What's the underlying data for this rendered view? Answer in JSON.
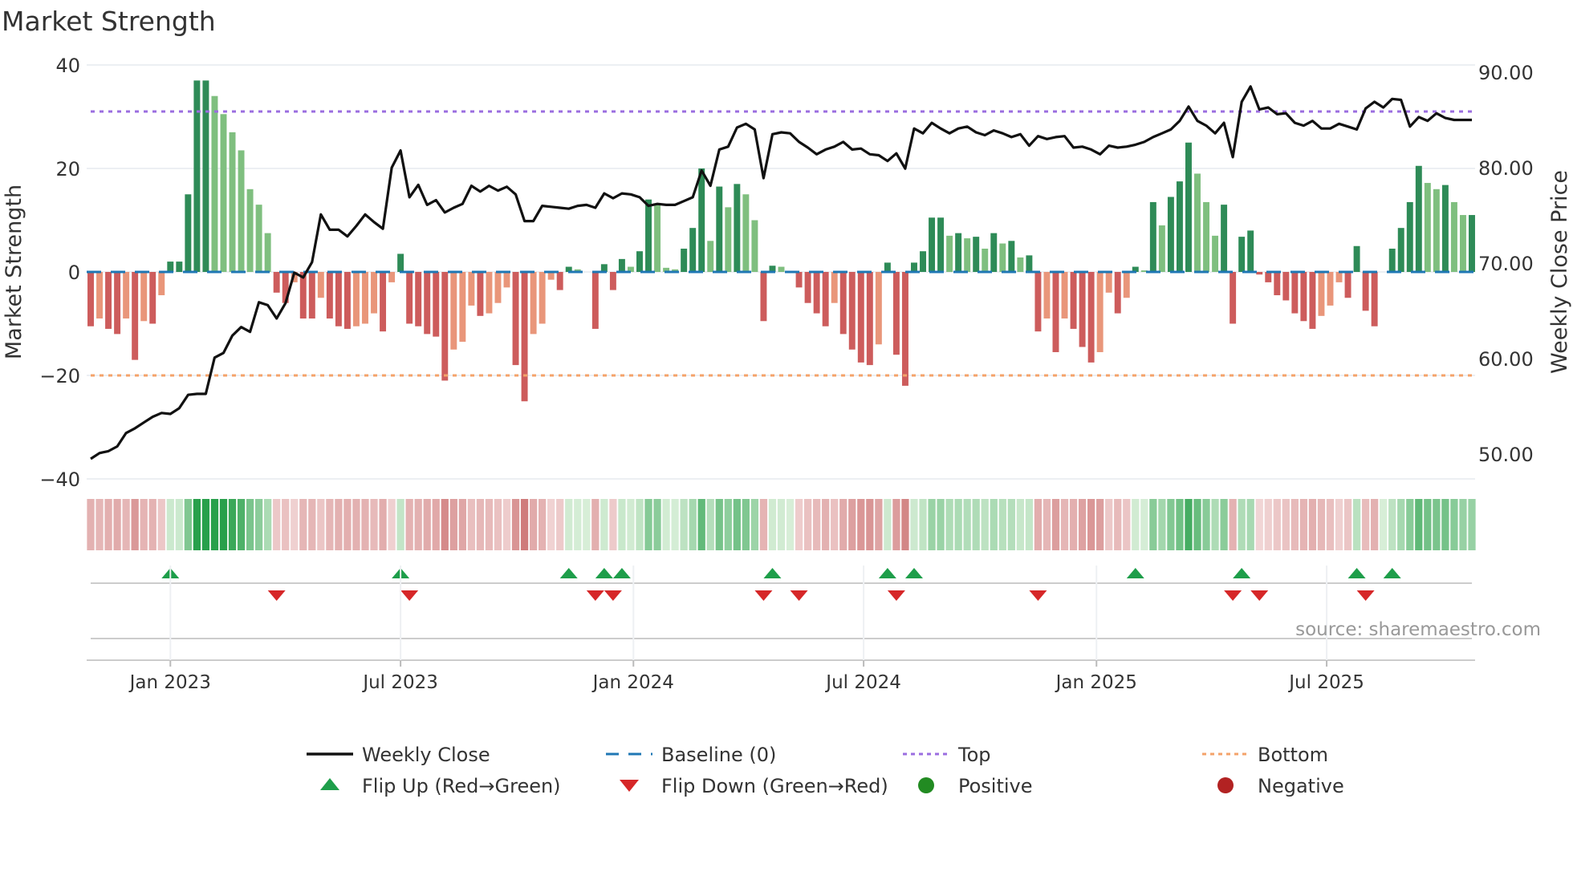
{
  "chart_data": {
    "type": "bar",
    "title": "Market Strength",
    "ylabel": "Market Strength",
    "y2label": "Weekly Close Price",
    "ylim": [
      -40,
      40
    ],
    "y2lim": [
      47,
      91
    ],
    "yticks": [
      40,
      20,
      0,
      -20,
      -40
    ],
    "ytick_labels": [
      "40",
      "20",
      "0",
      "−20",
      "−40"
    ],
    "y2ticks": [
      90,
      80,
      70,
      60,
      50
    ],
    "y2tick_labels": [
      "90.00",
      "80.00",
      "70.00",
      "60.00",
      "50.00"
    ],
    "x_unit": "week index",
    "xticks": [
      {
        "x": 9,
        "label": "Jan 2023"
      },
      {
        "x": 35,
        "label": "Jul 2023"
      },
      {
        "x": 61.3,
        "label": "Jan 2024"
      },
      {
        "x": 87.3,
        "label": "Jul 2024"
      },
      {
        "x": 113.6,
        "label": "Jan 2025"
      },
      {
        "x": 139.6,
        "label": "Jul 2025"
      }
    ],
    "top_level": 31,
    "bottom_level": -20,
    "baseline": 0,
    "strength": [
      -10.5,
      -9,
      -11,
      -12,
      -9,
      -17,
      -9.5,
      -10,
      -4.5,
      2,
      2,
      15,
      37,
      37,
      34,
      30.5,
      27,
      23.5,
      16,
      13,
      7.5,
      -4,
      -6,
      -2,
      -9,
      -9,
      -5,
      -9,
      -10.5,
      -11,
      -10.5,
      -10,
      -8,
      -11.5,
      -2,
      3.5,
      -10,
      -10.5,
      -12,
      -12.5,
      -21,
      -15,
      -13.5,
      -6.5,
      -8.5,
      -8,
      -6,
      -3,
      -18,
      -25,
      -12,
      -10,
      -1.5,
      -3.5,
      1,
      0.5,
      0,
      -11,
      1.5,
      -3.5,
      2.5,
      1,
      4,
      14,
      13,
      0.8,
      0.5,
      4.5,
      8.5,
      20,
      6,
      16.5,
      12.5,
      17,
      15,
      10,
      -9.5,
      1.2,
      1,
      0,
      -3,
      -6,
      -8,
      -10.5,
      -6,
      -12,
      -15,
      -17.5,
      -18,
      -14,
      1.8,
      -16,
      -22,
      1.8,
      4,
      10.5,
      10.5,
      7,
      7.5,
      6.5,
      6.8,
      4.5,
      7.5,
      5.5,
      6,
      2.8,
      3.2,
      -11.5,
      -9,
      -15.5,
      -9,
      -11,
      -14.5,
      -17.5,
      -15.5,
      -4,
      -8,
      -5,
      1,
      0.3,
      13.5,
      9,
      14.5,
      17.5,
      25,
      19,
      13.5,
      7,
      13,
      -10,
      6.8,
      8,
      -0.5,
      -2,
      -4.5,
      -5.5,
      -8,
      -9.5,
      -11,
      -8.5,
      -6.5,
      -2,
      -5,
      5,
      -7.5,
      -10.5,
      0,
      4.5,
      8.5,
      13.5,
      20.5,
      17.2,
      16,
      16.8,
      13.5,
      11,
      11
    ],
    "weekly_close": [
      49.5,
      50.1,
      50.3,
      50.8,
      52.2,
      52.7,
      53.3,
      53.9,
      54.3,
      54.2,
      54.8,
      56.2,
      56.3,
      56.3,
      60.1,
      60.6,
      62.4,
      63.3,
      62.8,
      65.9,
      65.6,
      64.2,
      65.8,
      69.0,
      68.5,
      70.1,
      75.1,
      73.5,
      73.5,
      72.8,
      73.9,
      75.1,
      74.3,
      73.6,
      80.0,
      81.8,
      76.9,
      78.2,
      76.1,
      76.6,
      75.3,
      75.8,
      76.2,
      78.1,
      77.5,
      78.1,
      77.6,
      78.0,
      77.2,
      74.4,
      74.4,
      76.0,
      75.9,
      75.8,
      75.7,
      76.0,
      76.1,
      75.8,
      77.3,
      76.8,
      77.3,
      77.2,
      76.9,
      76.0,
      76.2,
      76.1,
      76.1,
      76.5,
      76.9,
      79.7,
      78.1,
      81.9,
      82.2,
      84.2,
      84.6,
      84.0,
      78.9,
      83.5,
      83.7,
      83.6,
      82.7,
      82.1,
      81.4,
      81.9,
      82.2,
      82.7,
      81.9,
      82.0,
      81.4,
      81.3,
      80.7,
      81.5,
      79.9,
      84.1,
      83.6,
      84.7,
      84.1,
      83.6,
      84.1,
      84.3,
      83.7,
      83.4,
      83.9,
      83.6,
      83.2,
      83.5,
      82.3,
      83.3,
      83.0,
      83.2,
      83.3,
      82.1,
      82.2,
      81.9,
      81.4,
      82.3,
      82.1,
      82.2,
      82.4,
      82.7,
      83.2,
      83.6,
      84.0,
      84.9,
      86.4,
      84.9,
      84.4,
      83.6,
      84.7,
      81.1,
      86.9,
      88.5,
      86.1,
      86.3,
      85.6,
      85.7,
      84.7,
      84.4,
      84.9,
      84.1,
      84.1,
      84.6,
      84.3,
      84.0,
      86.2,
      86.9,
      86.3,
      87.2,
      87.1,
      84.3,
      85.3,
      84.9,
      85.7,
      85.2,
      85.0,
      85.0,
      85.0
    ],
    "flip_up_weeks": [
      9,
      35,
      54,
      58,
      60,
      77,
      90,
      93,
      118,
      130,
      143,
      147
    ],
    "flip_down_weeks": [
      21,
      36,
      57,
      59,
      76,
      80,
      91,
      107,
      129,
      132,
      144
    ],
    "legend": [
      {
        "label": "Weekly Close",
        "kind": "line",
        "color": "#111111"
      },
      {
        "label": "Baseline (0)",
        "kind": "dash",
        "color": "#1f77b4"
      },
      {
        "label": "Top",
        "kind": "dot",
        "color": "#9b6ee0"
      },
      {
        "label": "Bottom",
        "kind": "dot",
        "color": "#f4a36a"
      },
      {
        "label": "Flip Up (Red→Green)",
        "kind": "tri-up",
        "color": "#1e9e4a"
      },
      {
        "label": "Flip Down (Green→Red)",
        "kind": "tri-down",
        "color": "#d62728"
      },
      {
        "label": "Positive",
        "kind": "circle",
        "color": "#228b22"
      },
      {
        "label": "Negative",
        "kind": "circle",
        "color": "#b22222"
      }
    ],
    "legend_placement": "bottom",
    "grid": true,
    "colors": {
      "pos_rising": "#2e8b57",
      "pos_falling": "#7fbf7f",
      "neg_falling": "#cd5c5c",
      "neg_rising": "#e9967a"
    }
  },
  "source": "source: sharemaestro.com"
}
